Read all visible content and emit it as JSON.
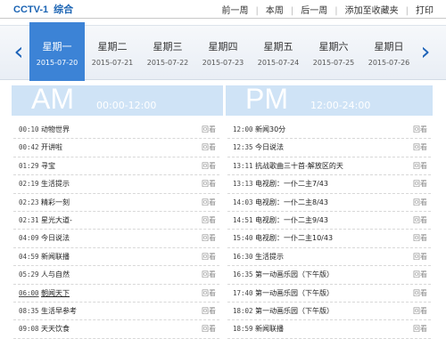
{
  "header": {
    "channel": "CCTV-1",
    "channel_sub": "综合",
    "links": [
      "前一周",
      "本周",
      "后一周",
      "添加至收藏夹",
      "打印"
    ]
  },
  "week": {
    "days": [
      {
        "name": "星期一",
        "date": "2015-07-20",
        "active": true
      },
      {
        "name": "星期二",
        "date": "2015-07-21"
      },
      {
        "name": "星期三",
        "date": "2015-07-22"
      },
      {
        "name": "星期四",
        "date": "2015-07-23"
      },
      {
        "name": "星期五",
        "date": "2015-07-24"
      },
      {
        "name": "星期六",
        "date": "2015-07-25"
      },
      {
        "name": "星期日",
        "date": "2015-07-26"
      }
    ],
    "prev_arrow": "‹",
    "next_arrow": "›"
  },
  "am": {
    "label": "AM",
    "range": "00:00-12:00",
    "programs": [
      {
        "time": "00:10",
        "title": "动物世界",
        "action": "回看"
      },
      {
        "time": "00:42",
        "title": "开讲啦",
        "action": "回看"
      },
      {
        "time": "01:29",
        "title": "寻宝",
        "action": "回看"
      },
      {
        "time": "02:19",
        "title": "生活提示",
        "action": "回看"
      },
      {
        "time": "02:23",
        "title": "精彩一刻",
        "action": "回看"
      },
      {
        "time": "02:31",
        "title": "星光大道-",
        "action": "回看"
      },
      {
        "time": "04:09",
        "title": "今日说法",
        "action": "回看"
      },
      {
        "time": "04:59",
        "title": "新闻联播",
        "action": "回看"
      },
      {
        "time": "05:29",
        "title": "人与自然",
        "action": "回看"
      },
      {
        "time": "06:00",
        "title": "朝闻天下",
        "action": "回看",
        "underline": true
      },
      {
        "time": "08:35",
        "title": "生活早参考",
        "action": "回看"
      },
      {
        "time": "09:08",
        "title": "天天饮食",
        "action": "回看"
      }
    ]
  },
  "pm": {
    "label": "PM",
    "range": "12:00-24:00",
    "programs": [
      {
        "time": "12:00",
        "title": "新闻30分",
        "action": "回看"
      },
      {
        "time": "12:35",
        "title": "今日说法",
        "action": "回看"
      },
      {
        "time": "13:11",
        "title": "抗战歌曲三十首-解放区的天",
        "action": "回看"
      },
      {
        "time": "13:13",
        "title": "电视剧：一仆二主7/43",
        "action": "回看"
      },
      {
        "time": "14:03",
        "title": "电视剧：一仆二主8/43",
        "action": "回看"
      },
      {
        "time": "14:51",
        "title": "电视剧：一仆二主9/43",
        "action": "回看"
      },
      {
        "time": "15:40",
        "title": "电视剧：一仆二主10/43",
        "action": "回看"
      },
      {
        "time": "16:30",
        "title": "生活提示",
        "action": "回看"
      },
      {
        "time": "16:35",
        "title": "第一动画乐园（下午版）",
        "action": "回看"
      },
      {
        "time": "17:40",
        "title": "第一动画乐园（下午版）",
        "action": "回看"
      },
      {
        "time": "18:02",
        "title": "第一动画乐园（下午版）",
        "action": "回看"
      },
      {
        "time": "18:59",
        "title": "新闻联播",
        "action": "回看"
      }
    ]
  }
}
